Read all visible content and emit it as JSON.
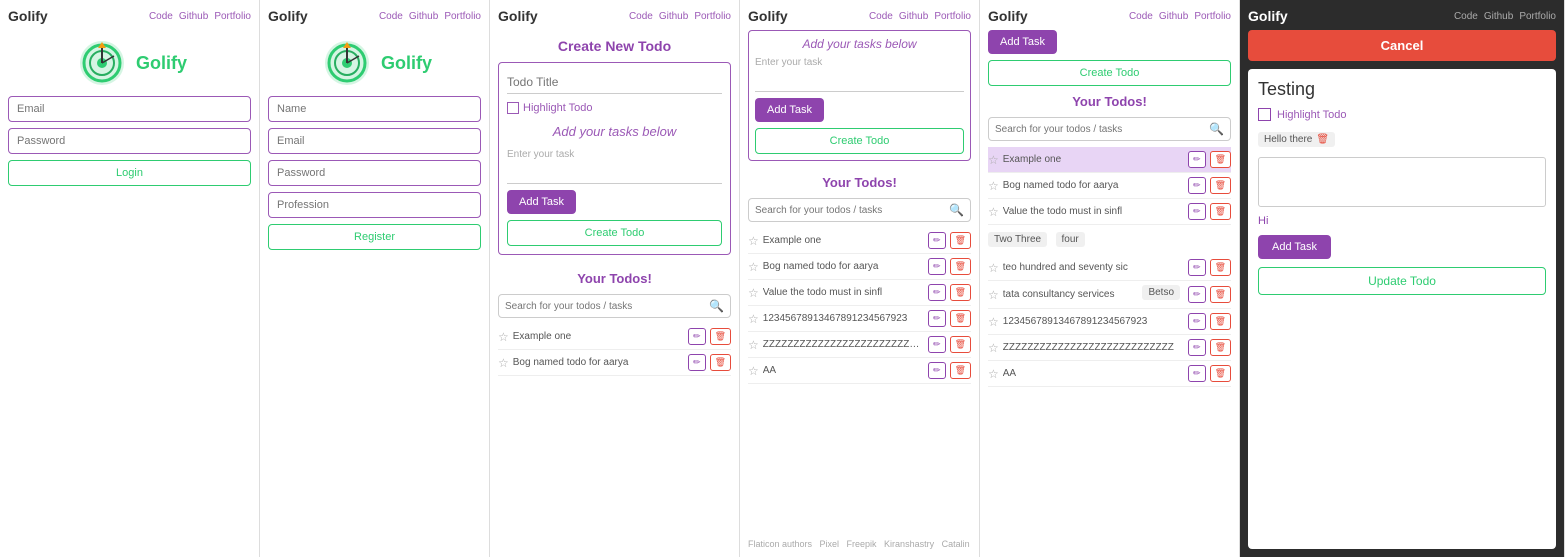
{
  "panels": [
    {
      "id": "panel1",
      "brand": "Golify",
      "nav_links": [
        "Code",
        "Github",
        "Portfolio"
      ],
      "form": {
        "email_placeholder": "Email",
        "password_placeholder": "Password",
        "login_label": "Login"
      }
    },
    {
      "id": "panel2",
      "brand": "Golify",
      "nav_links": [
        "Code",
        "Github",
        "Portfolio"
      ],
      "form": {
        "name_placeholder": "Name",
        "email_placeholder": "Email",
        "password_placeholder": "Password",
        "profession_placeholder": "Profession",
        "register_label": "Register"
      }
    },
    {
      "id": "panel3",
      "brand": "Golify",
      "nav_links": [
        "Code",
        "Github",
        "Portfolio"
      ],
      "create_todo": {
        "title": "Create New Todo",
        "todo_title_placeholder": "Todo Title",
        "highlight_label": "Highlight Todo",
        "add_tasks_text": "Add your tasks below",
        "enter_task_label": "Enter your task",
        "add_task_btn": "Add Task",
        "create_todo_btn": "Create Todo"
      },
      "your_todos": {
        "title": "Your Todos!",
        "search_placeholder": "Search for your todos / tasks",
        "items": [
          {
            "text": "Example one",
            "starred": false
          },
          {
            "text": "Bog named todo for aarya",
            "starred": false
          }
        ]
      }
    },
    {
      "id": "panel4",
      "brand": "Golify",
      "nav_links": [
        "Code",
        "Github",
        "Portfolio"
      ],
      "add_tasks_text": "Add your tasks below",
      "enter_task_label": "Enter your task",
      "add_task_btn": "Add Task",
      "create_todo_btn": "Create Todo",
      "your_todos": {
        "title": "Your Todos!",
        "search_placeholder": "Search for your todos / tasks",
        "items": [
          {
            "text": "Example one",
            "starred": false
          },
          {
            "text": "Bog named todo for aarya",
            "starred": false
          },
          {
            "text": "Value the todo must in sinfl",
            "starred": false
          },
          {
            "text": "12345678913467891234567923",
            "starred": false
          },
          {
            "text": "ZZZZZZZZZZZZZZZZZZZZZZZZZZZZZZZZZZ",
            "starred": false
          },
          {
            "text": "AA",
            "starred": false
          }
        ]
      },
      "footer": "Flaticon authors   Pixel  Freepik  Kiranshastry  Catalin"
    },
    {
      "id": "panel5",
      "brand": "Golify",
      "nav_links": [
        "Code",
        "Github",
        "Portfolio"
      ],
      "add_task_btn": "Add Task",
      "create_todo_btn": "Create Todo",
      "your_todos": {
        "title": "Your Todos!",
        "search_placeholder": "Search for your todos / tasks",
        "highlighted_item": "Example one",
        "items": [
          {
            "text": "Example one",
            "starred": false,
            "highlighted": true
          },
          {
            "text": "Bog named todo for aarya",
            "starred": false
          },
          {
            "text": "Value the todo must in sinfl",
            "starred": false
          }
        ],
        "tags1": [
          "Two Three",
          "four"
        ],
        "more_items": [
          {
            "text": "teo hundred and seventy sic",
            "starred": false
          },
          {
            "text": "tata consultancy services",
            "tag": "Betso"
          },
          {
            "text": "12345678913467891234567923",
            "starred": false
          },
          {
            "text": "ZZZZZZZZZZZZZZZZZZZZZZZZZZZZZZZZ",
            "starred": false
          },
          {
            "text": "AA",
            "starred": false
          }
        ]
      }
    },
    {
      "id": "panel6",
      "brand": "Golify",
      "nav_links": [
        "Code",
        "Github",
        "Portfolio"
      ],
      "cancel_label": "Cancel",
      "testing_text": "Testing",
      "highlight_label": "Highlight Todo",
      "tags": [
        "Hello there"
      ],
      "hi_text": "Hi",
      "add_task_btn": "Add Task",
      "update_todo_btn": "Update Todo"
    }
  ]
}
